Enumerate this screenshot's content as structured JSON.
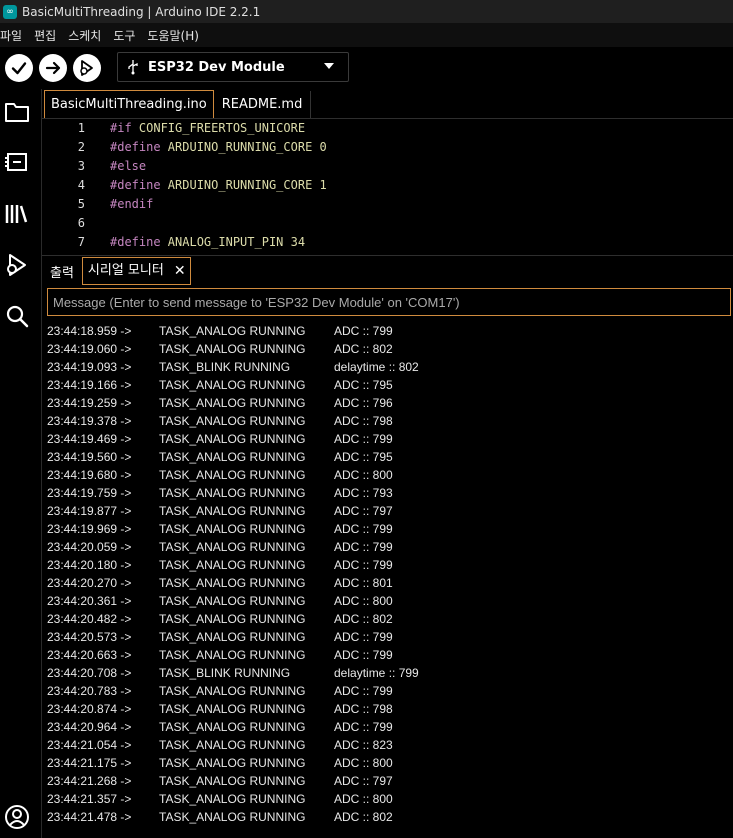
{
  "window": {
    "title": "BasicMultiThreading | Arduino IDE 2.2.1"
  },
  "menu": [
    "파일",
    "편집",
    "스케치",
    "도구",
    "도움말(H)"
  ],
  "toolbar": {
    "board": "ESP32 Dev Module"
  },
  "editor": {
    "tabs": [
      "BasicMultiThreading.ino",
      "README.md"
    ],
    "lines": [
      {
        "n": "1",
        "dir": "#if",
        "rest": " CONFIG_FREERTOS_UNICORE"
      },
      {
        "n": "2",
        "dir": "#define",
        "rest": " ARDUINO_RUNNING_CORE 0"
      },
      {
        "n": "3",
        "dir": "#else",
        "rest": ""
      },
      {
        "n": "4",
        "dir": "#define",
        "rest": " ARDUINO_RUNNING_CORE 1"
      },
      {
        "n": "5",
        "dir": "#endif",
        "rest": ""
      },
      {
        "n": "6",
        "dir": "",
        "rest": ""
      },
      {
        "n": "7",
        "dir": "#define",
        "rest": " ANALOG_INPUT_PIN 34"
      }
    ]
  },
  "panel": {
    "tabs": {
      "output": "출력",
      "serial": "시리얼 모니터"
    },
    "message_placeholder": "Message (Enter to send message to 'ESP32 Dev Module' on 'COM17')"
  },
  "serial_lines": [
    {
      "ts": "23:44:18.959 ->",
      "task": "TASK_ANALOG RUNNING",
      "val": "ADC :: 799"
    },
    {
      "ts": "23:44:19.060 ->",
      "task": "TASK_ANALOG RUNNING",
      "val": "ADC :: 802"
    },
    {
      "ts": "23:44:19.093 ->",
      "task": "TASK_BLINK RUNNING",
      "val": "delaytime :: 802"
    },
    {
      "ts": "23:44:19.166 ->",
      "task": "TASK_ANALOG RUNNING",
      "val": "ADC :: 795"
    },
    {
      "ts": "23:44:19.259 ->",
      "task": "TASK_ANALOG RUNNING",
      "val": "ADC :: 796"
    },
    {
      "ts": "23:44:19.378 ->",
      "task": "TASK_ANALOG RUNNING",
      "val": "ADC :: 798"
    },
    {
      "ts": "23:44:19.469 ->",
      "task": "TASK_ANALOG RUNNING",
      "val": "ADC :: 799"
    },
    {
      "ts": "23:44:19.560 ->",
      "task": "TASK_ANALOG RUNNING",
      "val": "ADC :: 795"
    },
    {
      "ts": "23:44:19.680 ->",
      "task": "TASK_ANALOG RUNNING",
      "val": "ADC :: 800"
    },
    {
      "ts": "23:44:19.759 ->",
      "task": "TASK_ANALOG RUNNING",
      "val": "ADC :: 793"
    },
    {
      "ts": "23:44:19.877 ->",
      "task": "TASK_ANALOG RUNNING",
      "val": "ADC :: 797"
    },
    {
      "ts": "23:44:19.969 ->",
      "task": "TASK_ANALOG RUNNING",
      "val": "ADC :: 799"
    },
    {
      "ts": "23:44:20.059 ->",
      "task": "TASK_ANALOG RUNNING",
      "val": "ADC :: 799"
    },
    {
      "ts": "23:44:20.180 ->",
      "task": "TASK_ANALOG RUNNING",
      "val": "ADC :: 799"
    },
    {
      "ts": "23:44:20.270 ->",
      "task": "TASK_ANALOG RUNNING",
      "val": "ADC :: 801"
    },
    {
      "ts": "23:44:20.361 ->",
      "task": "TASK_ANALOG RUNNING",
      "val": "ADC :: 800"
    },
    {
      "ts": "23:44:20.482 ->",
      "task": "TASK_ANALOG RUNNING",
      "val": "ADC :: 802"
    },
    {
      "ts": "23:44:20.573 ->",
      "task": "TASK_ANALOG RUNNING",
      "val": "ADC :: 799"
    },
    {
      "ts": "23:44:20.663 ->",
      "task": "TASK_ANALOG RUNNING",
      "val": "ADC :: 799"
    },
    {
      "ts": "23:44:20.708 ->",
      "task": "TASK_BLINK RUNNING",
      "val": "delaytime :: 799"
    },
    {
      "ts": "23:44:20.783 ->",
      "task": "TASK_ANALOG RUNNING",
      "val": "ADC :: 799"
    },
    {
      "ts": "23:44:20.874 ->",
      "task": "TASK_ANALOG RUNNING",
      "val": "ADC :: 798"
    },
    {
      "ts": "23:44:20.964 ->",
      "task": "TASK_ANALOG RUNNING",
      "val": "ADC :: 799"
    },
    {
      "ts": "23:44:21.054 ->",
      "task": "TASK_ANALOG RUNNING",
      "val": "ADC :: 823"
    },
    {
      "ts": "23:44:21.175 ->",
      "task": "TASK_ANALOG RUNNING",
      "val": "ADC :: 800"
    },
    {
      "ts": "23:44:21.268 ->",
      "task": "TASK_ANALOG RUNNING",
      "val": "ADC :: 797"
    },
    {
      "ts": "23:44:21.357 ->",
      "task": "TASK_ANALOG RUNNING",
      "val": "ADC :: 800"
    },
    {
      "ts": "23:44:21.478 ->",
      "task": "TASK_ANALOG RUNNING",
      "val": "ADC :: 802"
    }
  ],
  "icons": {
    "verify": "check-icon",
    "upload": "arrow-right-icon",
    "debug": "debug-icon",
    "sidebar": [
      "folder-icon",
      "board-manager-icon",
      "library-icon",
      "debug-icon",
      "search-icon",
      "account-icon"
    ]
  },
  "colors": {
    "accent": "#d08b3e",
    "brand": "#00979d",
    "directive": "#c586c0"
  }
}
